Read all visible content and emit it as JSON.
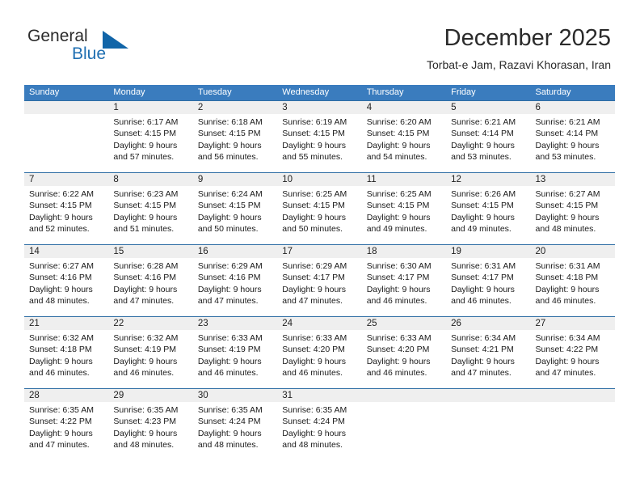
{
  "brand": {
    "name_part1": "General",
    "name_part2": "Blue",
    "accent_color": "#1165a8"
  },
  "header": {
    "title": "December 2025",
    "subtitle": "Torbat-e Jam, Razavi Khorasan, Iran"
  },
  "calendar": {
    "header_bg": "#3a7cbe",
    "row_border": "#2e6da4",
    "daynum_band_bg": "#efefef",
    "weekdays": [
      "Sunday",
      "Monday",
      "Tuesday",
      "Wednesday",
      "Thursday",
      "Friday",
      "Saturday"
    ],
    "weeks": [
      [
        {
          "day": "",
          "lines": []
        },
        {
          "day": "1",
          "lines": [
            "Sunrise: 6:17 AM",
            "Sunset: 4:15 PM",
            "Daylight: 9 hours",
            "and 57 minutes."
          ]
        },
        {
          "day": "2",
          "lines": [
            "Sunrise: 6:18 AM",
            "Sunset: 4:15 PM",
            "Daylight: 9 hours",
            "and 56 minutes."
          ]
        },
        {
          "day": "3",
          "lines": [
            "Sunrise: 6:19 AM",
            "Sunset: 4:15 PM",
            "Daylight: 9 hours",
            "and 55 minutes."
          ]
        },
        {
          "day": "4",
          "lines": [
            "Sunrise: 6:20 AM",
            "Sunset: 4:15 PM",
            "Daylight: 9 hours",
            "and 54 minutes."
          ]
        },
        {
          "day": "5",
          "lines": [
            "Sunrise: 6:21 AM",
            "Sunset: 4:14 PM",
            "Daylight: 9 hours",
            "and 53 minutes."
          ]
        },
        {
          "day": "6",
          "lines": [
            "Sunrise: 6:21 AM",
            "Sunset: 4:14 PM",
            "Daylight: 9 hours",
            "and 53 minutes."
          ]
        }
      ],
      [
        {
          "day": "7",
          "lines": [
            "Sunrise: 6:22 AM",
            "Sunset: 4:15 PM",
            "Daylight: 9 hours",
            "and 52 minutes."
          ]
        },
        {
          "day": "8",
          "lines": [
            "Sunrise: 6:23 AM",
            "Sunset: 4:15 PM",
            "Daylight: 9 hours",
            "and 51 minutes."
          ]
        },
        {
          "day": "9",
          "lines": [
            "Sunrise: 6:24 AM",
            "Sunset: 4:15 PM",
            "Daylight: 9 hours",
            "and 50 minutes."
          ]
        },
        {
          "day": "10",
          "lines": [
            "Sunrise: 6:25 AM",
            "Sunset: 4:15 PM",
            "Daylight: 9 hours",
            "and 50 minutes."
          ]
        },
        {
          "day": "11",
          "lines": [
            "Sunrise: 6:25 AM",
            "Sunset: 4:15 PM",
            "Daylight: 9 hours",
            "and 49 minutes."
          ]
        },
        {
          "day": "12",
          "lines": [
            "Sunrise: 6:26 AM",
            "Sunset: 4:15 PM",
            "Daylight: 9 hours",
            "and 49 minutes."
          ]
        },
        {
          "day": "13",
          "lines": [
            "Sunrise: 6:27 AM",
            "Sunset: 4:15 PM",
            "Daylight: 9 hours",
            "and 48 minutes."
          ]
        }
      ],
      [
        {
          "day": "14",
          "lines": [
            "Sunrise: 6:27 AM",
            "Sunset: 4:16 PM",
            "Daylight: 9 hours",
            "and 48 minutes."
          ]
        },
        {
          "day": "15",
          "lines": [
            "Sunrise: 6:28 AM",
            "Sunset: 4:16 PM",
            "Daylight: 9 hours",
            "and 47 minutes."
          ]
        },
        {
          "day": "16",
          "lines": [
            "Sunrise: 6:29 AM",
            "Sunset: 4:16 PM",
            "Daylight: 9 hours",
            "and 47 minutes."
          ]
        },
        {
          "day": "17",
          "lines": [
            "Sunrise: 6:29 AM",
            "Sunset: 4:17 PM",
            "Daylight: 9 hours",
            "and 47 minutes."
          ]
        },
        {
          "day": "18",
          "lines": [
            "Sunrise: 6:30 AM",
            "Sunset: 4:17 PM",
            "Daylight: 9 hours",
            "and 46 minutes."
          ]
        },
        {
          "day": "19",
          "lines": [
            "Sunrise: 6:31 AM",
            "Sunset: 4:17 PM",
            "Daylight: 9 hours",
            "and 46 minutes."
          ]
        },
        {
          "day": "20",
          "lines": [
            "Sunrise: 6:31 AM",
            "Sunset: 4:18 PM",
            "Daylight: 9 hours",
            "and 46 minutes."
          ]
        }
      ],
      [
        {
          "day": "21",
          "lines": [
            "Sunrise: 6:32 AM",
            "Sunset: 4:18 PM",
            "Daylight: 9 hours",
            "and 46 minutes."
          ]
        },
        {
          "day": "22",
          "lines": [
            "Sunrise: 6:32 AM",
            "Sunset: 4:19 PM",
            "Daylight: 9 hours",
            "and 46 minutes."
          ]
        },
        {
          "day": "23",
          "lines": [
            "Sunrise: 6:33 AM",
            "Sunset: 4:19 PM",
            "Daylight: 9 hours",
            "and 46 minutes."
          ]
        },
        {
          "day": "24",
          "lines": [
            "Sunrise: 6:33 AM",
            "Sunset: 4:20 PM",
            "Daylight: 9 hours",
            "and 46 minutes."
          ]
        },
        {
          "day": "25",
          "lines": [
            "Sunrise: 6:33 AM",
            "Sunset: 4:20 PM",
            "Daylight: 9 hours",
            "and 46 minutes."
          ]
        },
        {
          "day": "26",
          "lines": [
            "Sunrise: 6:34 AM",
            "Sunset: 4:21 PM",
            "Daylight: 9 hours",
            "and 47 minutes."
          ]
        },
        {
          "day": "27",
          "lines": [
            "Sunrise: 6:34 AM",
            "Sunset: 4:22 PM",
            "Daylight: 9 hours",
            "and 47 minutes."
          ]
        }
      ],
      [
        {
          "day": "28",
          "lines": [
            "Sunrise: 6:35 AM",
            "Sunset: 4:22 PM",
            "Daylight: 9 hours",
            "and 47 minutes."
          ]
        },
        {
          "day": "29",
          "lines": [
            "Sunrise: 6:35 AM",
            "Sunset: 4:23 PM",
            "Daylight: 9 hours",
            "and 48 minutes."
          ]
        },
        {
          "day": "30",
          "lines": [
            "Sunrise: 6:35 AM",
            "Sunset: 4:24 PM",
            "Daylight: 9 hours",
            "and 48 minutes."
          ]
        },
        {
          "day": "31",
          "lines": [
            "Sunrise: 6:35 AM",
            "Sunset: 4:24 PM",
            "Daylight: 9 hours",
            "and 48 minutes."
          ]
        },
        {
          "day": "",
          "lines": []
        },
        {
          "day": "",
          "lines": []
        },
        {
          "day": "",
          "lines": []
        }
      ]
    ]
  }
}
